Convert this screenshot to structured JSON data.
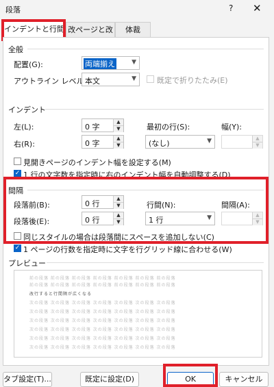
{
  "window": {
    "title": "段落",
    "help": "?",
    "close": "✕"
  },
  "tabs": [
    "インデントと行間隔",
    "改ページと改行",
    "体裁"
  ],
  "general": {
    "heading": "全般",
    "alignment_label": "配置(G):",
    "alignment_value": "両端揃え",
    "outline_label": "アウトライン レベル(O):",
    "outline_value": "本文",
    "collapsed_label": "既定で折りたたみ(E)"
  },
  "indent": {
    "heading": "インデント",
    "left_label": "左(L):",
    "left_value": "0 字",
    "right_label": "右(R):",
    "right_value": "0 字",
    "first_line_label": "最初の行(S):",
    "first_line_value": "(なし)",
    "width_label": "幅(Y):",
    "width_value": "",
    "mirror_label": "見開きページのインデント幅を設定する(M)",
    "auto_adjust_label": "1 行の文字数を指定時に右のインデント幅を自動調整する(D)"
  },
  "spacing": {
    "heading": "間隔",
    "before_label": "段落前(B):",
    "before_value": "0 行",
    "after_label": "段落後(E):",
    "after_value": "0 行",
    "line_label": "行間(N):",
    "line_value": "1 行",
    "at_label": "間隔(A):",
    "at_value": "",
    "no_space_label": "同じスタイルの場合は段落間にスペースを追加しない(C)",
    "grid_label": "1 ページの行数を指定時に文字を行グリッド線に合わせる(W)"
  },
  "preview": {
    "heading": "プレビュー",
    "main_line": "改行すると行間隔が広くなる",
    "filler": "前の段落 前の段落 前の段落 前の段落 前の段落 前の段落 前の段落",
    "filler_next": "次の段落 次の段落 次の段落 次の段落 次の段落 次の段落 次の段落"
  },
  "buttons": {
    "tabs": "タブ設定(T)...",
    "default": "既定に設定(D)",
    "ok": "OK",
    "cancel": "キャンセル"
  },
  "colors": {
    "highlight": "#e0202a",
    "accent": "#0a64c8"
  }
}
